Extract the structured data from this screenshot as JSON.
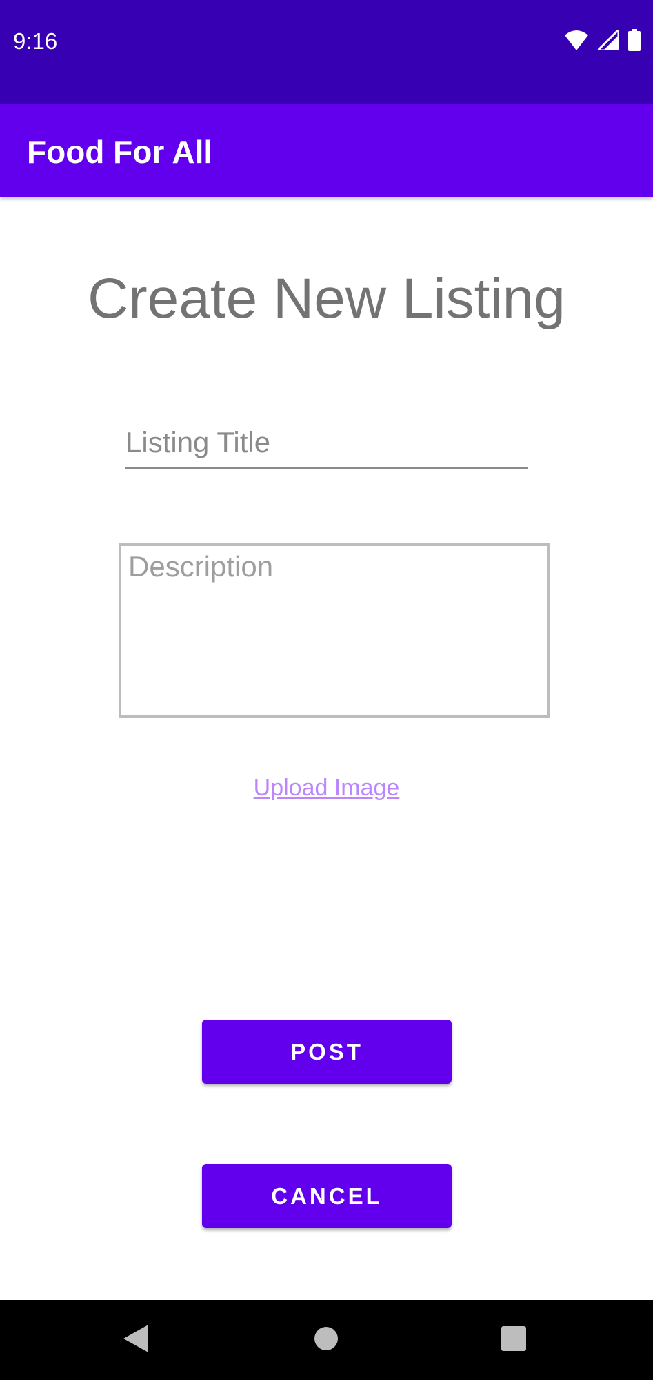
{
  "status_bar": {
    "time": "9:16",
    "icons": [
      "wifi-icon",
      "cellular-signal-icon",
      "battery-icon"
    ]
  },
  "app_bar": {
    "title": "Food For All"
  },
  "form": {
    "heading": "Create New Listing",
    "title_field": {
      "placeholder": "Listing Title",
      "value": ""
    },
    "description_field": {
      "placeholder": "Description",
      "value": ""
    },
    "upload_link": "Upload Image"
  },
  "buttons": {
    "post": "POST",
    "cancel": "CANCEL"
  },
  "navigation_bar": {
    "icons": [
      "back-icon",
      "home-icon",
      "recents-icon"
    ]
  },
  "colors": {
    "status_bar": "#3700b3",
    "primary": "#6200ee",
    "link": "#bb86fc"
  }
}
